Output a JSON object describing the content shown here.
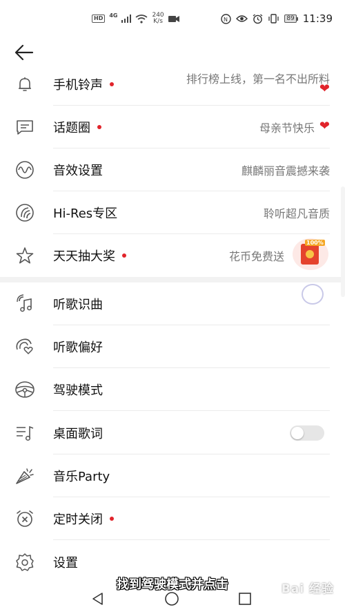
{
  "status_bar": {
    "hd": "HD",
    "network": "4G",
    "speed_value": "240",
    "speed_unit": "K/s",
    "battery": "89",
    "time": "11:39"
  },
  "menu": {
    "section1": [
      {
        "label": "手机铃声",
        "dot": true,
        "right": "排行榜上线，第一名不出所料"
      },
      {
        "label": "话题圈",
        "dot": true,
        "right": "母亲节快乐"
      },
      {
        "label": "音效设置",
        "dot": false,
        "right": "麒麟丽音震撼来袭"
      },
      {
        "label": "Hi-Res专区",
        "dot": false,
        "right": "聆听超凡音质"
      },
      {
        "label": "天天抽大奖",
        "dot": true,
        "right": "花币免费送"
      }
    ],
    "section2": [
      {
        "label": "听歌识曲"
      },
      {
        "label": "听歌偏好"
      },
      {
        "label": "驾驶模式"
      },
      {
        "label": "桌面歌词"
      },
      {
        "label": "音乐Party"
      },
      {
        "label": "定时关闭",
        "dot": true
      },
      {
        "label": "设置"
      }
    ]
  },
  "redpacket_badge": "100%",
  "desktop_lyrics_enabled": false,
  "subtitle": "找到驾驶模式并点击",
  "watermark": "Bai 经验",
  "colors": {
    "accent_red": "#e1242b",
    "divider": "#ebebeb"
  }
}
